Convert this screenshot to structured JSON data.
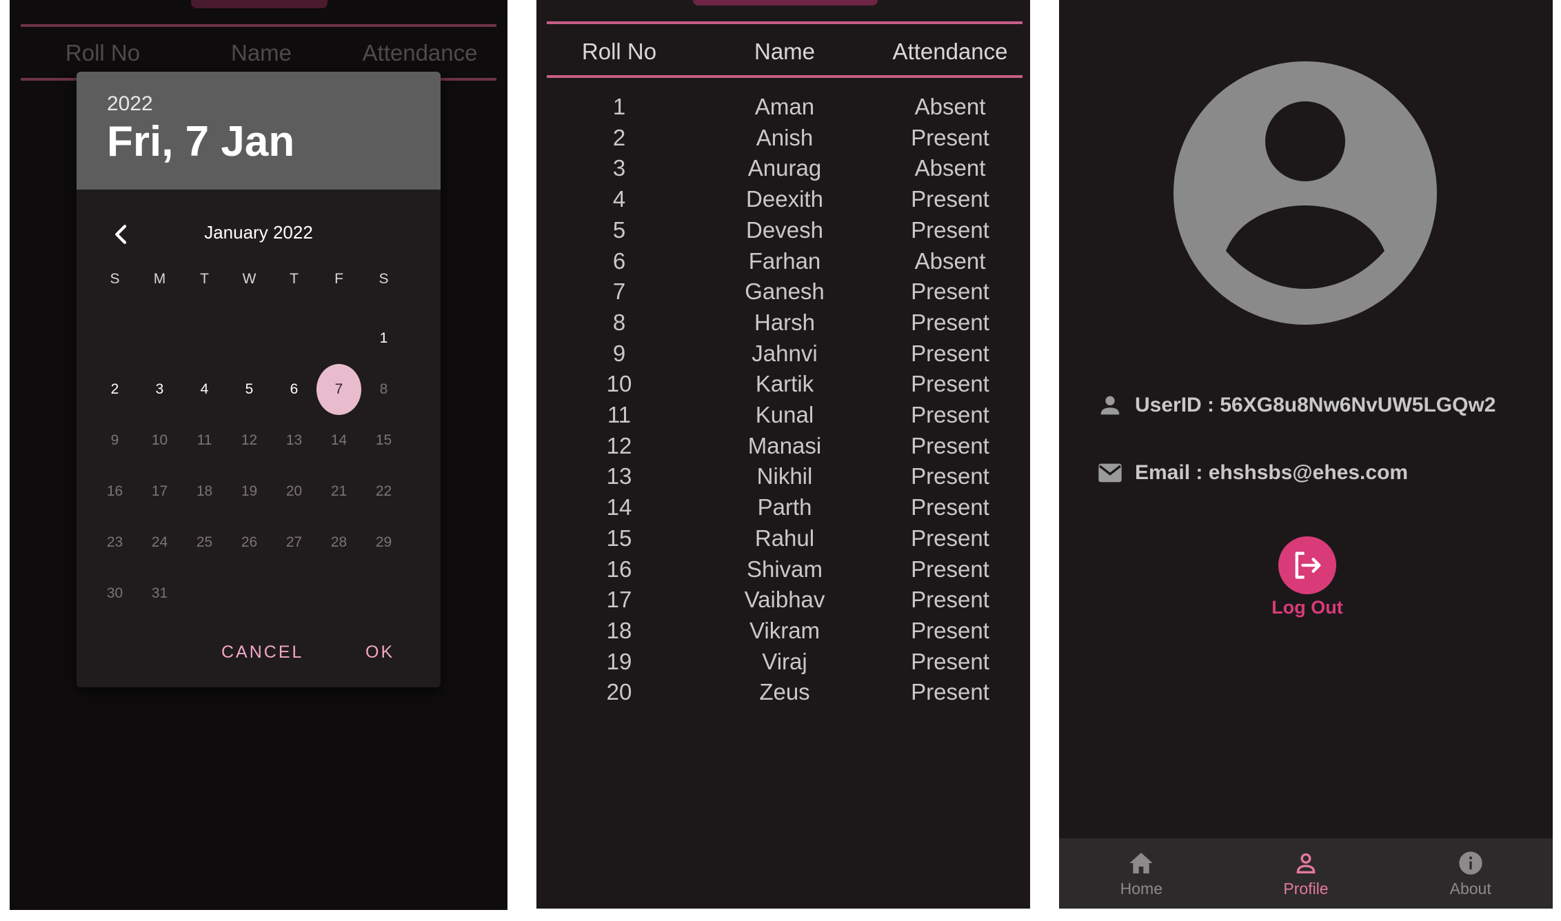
{
  "date_picker_screen": {
    "table_headers": [
      "Roll No",
      "Name",
      "Attendance"
    ],
    "dialog": {
      "year": "2022",
      "selected_date": "Fri, 7 Jan",
      "month_label": "January 2022",
      "weekdays": [
        "S",
        "M",
        "T",
        "W",
        "T",
        "F",
        "S"
      ],
      "leading_blank_days": 6,
      "days": [
        "1",
        "2",
        "3",
        "4",
        "5",
        "6",
        "7",
        "8",
        "9",
        "10",
        "11",
        "12",
        "13",
        "14",
        "15",
        "16",
        "17",
        "18",
        "19",
        "20",
        "21",
        "22",
        "23",
        "24",
        "25",
        "26",
        "27",
        "28",
        "29",
        "30",
        "31"
      ],
      "selected_day": "7",
      "last_enabled_day": "7",
      "cancel_label": "CANCEL",
      "ok_label": "OK"
    }
  },
  "attendance_screen": {
    "headers": [
      "Roll No",
      "Name",
      "Attendance"
    ],
    "rows": [
      {
        "roll": "1",
        "name": "Aman",
        "status": "Absent"
      },
      {
        "roll": "2",
        "name": "Anish",
        "status": "Present"
      },
      {
        "roll": "3",
        "name": "Anurag",
        "status": "Absent"
      },
      {
        "roll": "4",
        "name": "Deexith",
        "status": "Present"
      },
      {
        "roll": "5",
        "name": "Devesh",
        "status": "Present"
      },
      {
        "roll": "6",
        "name": "Farhan",
        "status": "Absent"
      },
      {
        "roll": "7",
        "name": "Ganesh",
        "status": "Present"
      },
      {
        "roll": "8",
        "name": "Harsh",
        "status": "Present"
      },
      {
        "roll": "9",
        "name": "Jahnvi",
        "status": "Present"
      },
      {
        "roll": "10",
        "name": "Kartik",
        "status": "Present"
      },
      {
        "roll": "11",
        "name": "Kunal",
        "status": "Present"
      },
      {
        "roll": "12",
        "name": "Manasi",
        "status": "Present"
      },
      {
        "roll": "13",
        "name": "Nikhil",
        "status": "Present"
      },
      {
        "roll": "14",
        "name": "Parth",
        "status": "Present"
      },
      {
        "roll": "15",
        "name": "Rahul",
        "status": "Present"
      },
      {
        "roll": "16",
        "name": "Shivam",
        "status": "Present"
      },
      {
        "roll": "17",
        "name": "Vaibhav",
        "status": "Present"
      },
      {
        "roll": "18",
        "name": "Vikram",
        "status": "Present"
      },
      {
        "roll": "19",
        "name": "Viraj",
        "status": "Present"
      },
      {
        "roll": "20",
        "name": "Zeus",
        "status": "Present"
      }
    ]
  },
  "profile_screen": {
    "avatar_icon": "account-circle-icon",
    "user_id_label": "UserID : 56XG8u8Nw6NvUW5LGQw2",
    "email_label": "Email  : ehshsbs@ehes.com",
    "logout_label": "Log Out",
    "nav": [
      {
        "label": "Home",
        "icon": "home-icon",
        "active": false
      },
      {
        "label": "Profile",
        "icon": "person-icon",
        "active": true
      },
      {
        "label": "About",
        "icon": "info-icon",
        "active": false
      }
    ],
    "accent_color": "#d93b78"
  }
}
